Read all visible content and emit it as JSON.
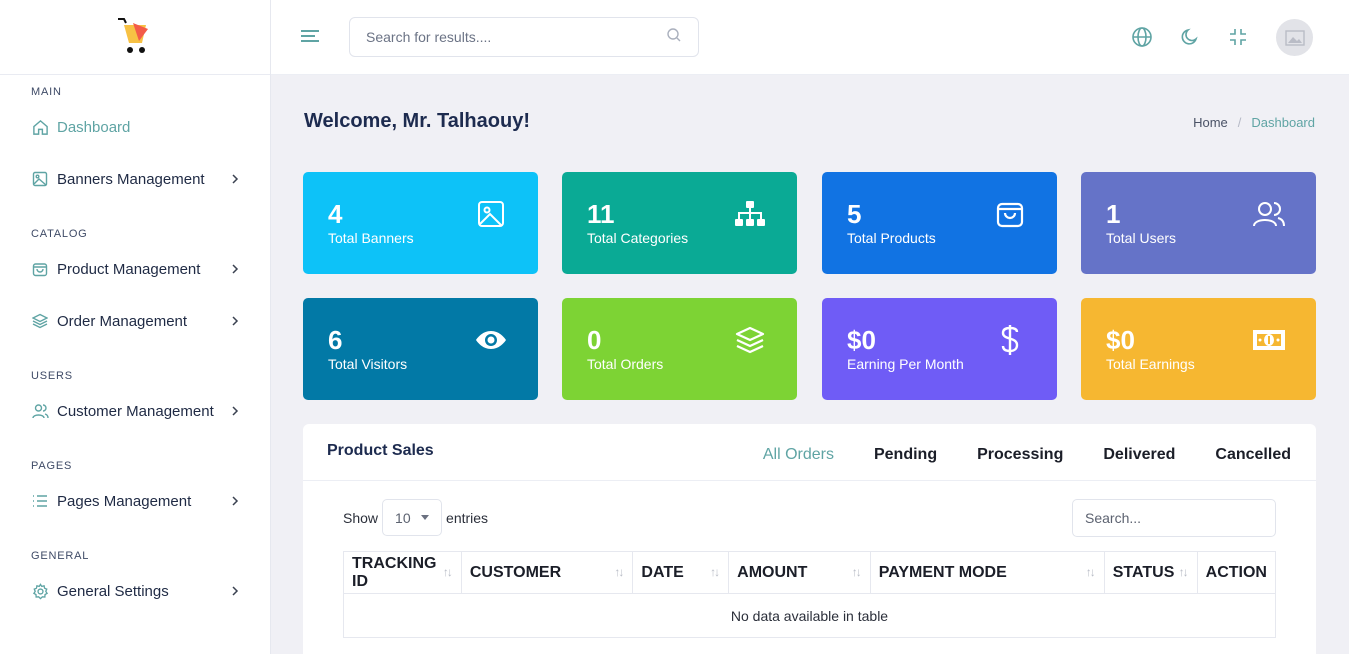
{
  "sidebar": {
    "sections": [
      {
        "label": "MAIN",
        "items": [
          {
            "label": "Dashboard",
            "icon": "home-icon",
            "active": true,
            "chevron": false
          },
          {
            "label": "Banners Management",
            "icon": "image-icon",
            "chevron": true
          }
        ]
      },
      {
        "label": "CATALOG",
        "items": [
          {
            "label": "Product Management",
            "icon": "shopping-bag-icon",
            "chevron": true
          },
          {
            "label": "Order Management",
            "icon": "layers-icon",
            "chevron": true
          }
        ]
      },
      {
        "label": "USERS",
        "items": [
          {
            "label": "Customer Management",
            "icon": "users-icon",
            "chevron": true
          }
        ]
      },
      {
        "label": "PAGES",
        "items": [
          {
            "label": "Pages Management",
            "icon": "list-icon",
            "chevron": true
          }
        ]
      },
      {
        "label": "GENERAL",
        "items": [
          {
            "label": "General Settings",
            "icon": "gear-icon",
            "chevron": true
          }
        ]
      }
    ]
  },
  "header": {
    "search_placeholder": "Search for results....",
    "icons": [
      "globe-icon",
      "moon-icon",
      "minimize-icon",
      "avatar-image-icon"
    ]
  },
  "page": {
    "welcome": "Welcome, Mr. Talhaouy!",
    "breadcrumb": {
      "home": "Home",
      "separator": "/",
      "current": "Dashboard"
    }
  },
  "cards": [
    {
      "value": "4",
      "label": "Total Banners",
      "color": "#0dc2f8",
      "icon": "image-icon"
    },
    {
      "value": "11",
      "label": "Total Categories",
      "color": "#0aaa95",
      "icon": "sitemap-icon"
    },
    {
      "value": "5",
      "label": "Total Products",
      "color": "#1173e3",
      "icon": "shopping-bag-icon"
    },
    {
      "value": "1",
      "label": "Total Users",
      "color": "#6573c8",
      "icon": "users-icon"
    },
    {
      "value": "6",
      "label": "Total Visitors",
      "color": "#0279a6",
      "icon": "eye-icon"
    },
    {
      "value": "0",
      "label": "Total Orders",
      "color": "#7dd334",
      "icon": "layers-icon"
    },
    {
      "value": "$0",
      "label": "Earning Per Month",
      "color": "#6f5cf6",
      "icon": "dollar-icon"
    },
    {
      "value": "$0",
      "label": "Total Earnings",
      "color": "#f6b731",
      "icon": "banknote-icon"
    }
  ],
  "sales": {
    "title": "Product Sales",
    "tabs": [
      "All Orders",
      "Pending",
      "Processing",
      "Delivered",
      "Cancelled"
    ],
    "active_tab": "All Orders",
    "show_label": "Show",
    "entries_value": "10",
    "entries_label": "entries",
    "search_placeholder": "Search...",
    "columns": [
      "TRACKING ID",
      "CUSTOMER",
      "DATE",
      "AMOUNT",
      "PAYMENT MODE",
      "STATUS",
      "ACTION"
    ],
    "empty_message": "No data available in table"
  },
  "colors": {
    "accent": "#5fa4a4",
    "text": "#1d2b4f",
    "background": "#f0f0f5"
  }
}
